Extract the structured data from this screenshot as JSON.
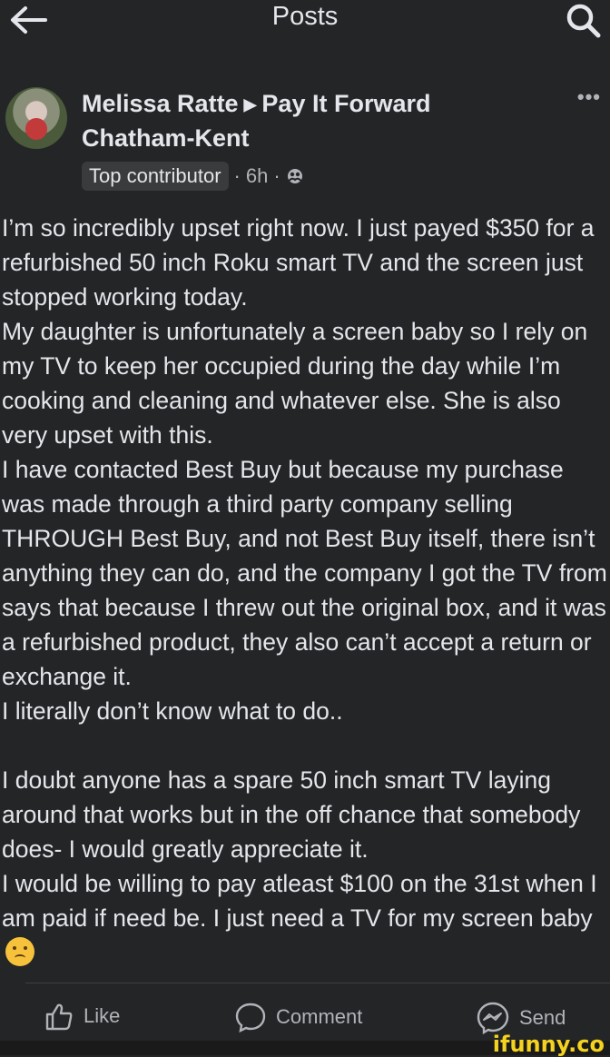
{
  "topbar": {
    "title": "Posts"
  },
  "post": {
    "author": "Melissa Ratte",
    "group": "Pay It Forward Chatham-Kent",
    "badge": "Top contributor",
    "time": "6h",
    "body": "I’m so incredibly upset right now. I just payed $350 for a refurbished 50 inch Roku smart TV and the screen just stopped working today.\nMy daughter is unfortunately a screen baby so I rely on my TV to keep her occupied during the day while I’m cooking and cleaning and whatever else. She is also very upset with this.\nI have contacted Best Buy but because my purchase was made through a third party company selling THROUGH Best Buy, and not Best Buy itself, there isn’t anything they can do, and the company I got the TV from says that because I threw out the original box, and it was a refurbished product, they also can’t accept a return or exchange it.\nI literally don’t know what to do..\n\nI doubt anyone has a spare 50 inch smart TV laying around that works but in the off chance that somebody does- I would greatly appreciate it.\nI would be willing to pay atleast $100 on the 31st when I am paid if need be. I just need a TV for my screen baby"
  },
  "actions": {
    "like": "Like",
    "comment": "Comment",
    "send": "Send"
  },
  "watermark": "ifunny.co",
  "icons": {
    "back": "back-arrow-icon",
    "search": "search-icon",
    "more": "more-icon",
    "privacy": "group-privacy-icon",
    "emoji": "tearful-smile-emoji-icon",
    "like": "thumbs-up-icon",
    "comment": "comment-bubble-icon",
    "send": "messenger-icon"
  },
  "colors": {
    "background": "#242526",
    "text": "#e4e6eb",
    "secondary": "#b0b3b8",
    "badge": "#3a3b3c",
    "watermark": "#f4d21e"
  }
}
